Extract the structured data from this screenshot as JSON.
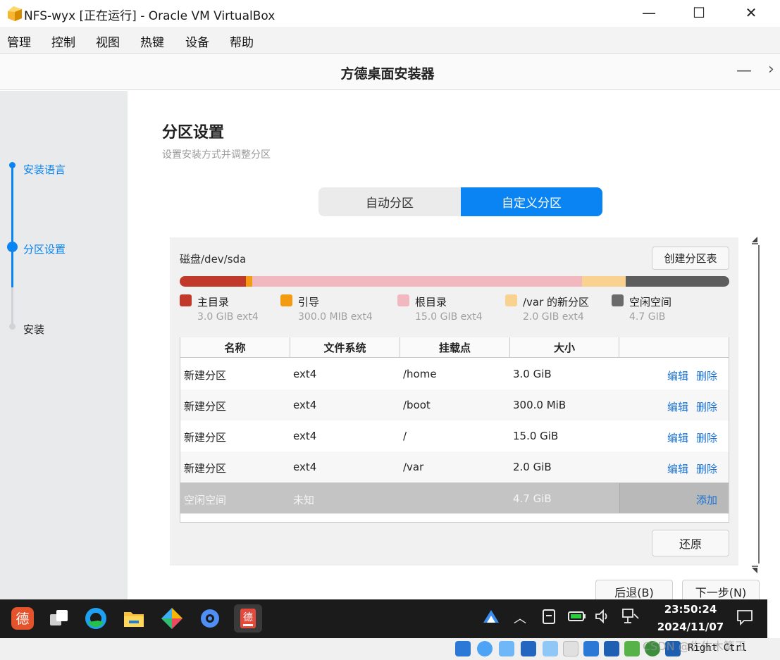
{
  "window": {
    "title": "NFS-wyx [正在运行] - Oracle VM VirtualBox",
    "minimize": "—",
    "maximize": "☐",
    "close": "✕",
    "icon": "virtualbox-icon"
  },
  "menu": [
    "管理",
    "控制",
    "视图",
    "热键",
    "设备",
    "帮助"
  ],
  "installer": {
    "title": "方德桌面安装器",
    "minimize": "—",
    "next_arrow": "›"
  },
  "steps": [
    {
      "label": "安装语言",
      "state": "done"
    },
    {
      "label": "分区设置",
      "state": "current"
    },
    {
      "label": "安装",
      "state": "pending"
    }
  ],
  "page": {
    "title": "分区设置",
    "subtitle": "设置安装方式并调整分区"
  },
  "tabs": {
    "auto": "自动分区",
    "custom": "自定义分区",
    "active": "custom"
  },
  "disk": {
    "label": "磁盘/dev/sda",
    "create_table_button": "创建分区表",
    "usage_segments": [
      {
        "name": "主目录",
        "gib": 3.0,
        "color": "#c0392b"
      },
      {
        "name": "引导",
        "gib": 0.293,
        "color": "#f39c12"
      },
      {
        "name": "根目录",
        "gib": 15.0,
        "color": "#f2b8c0"
      },
      {
        "name": "/var 的新分区",
        "gib": 2.0,
        "color": "#f8d28e"
      },
      {
        "name": "空闲空间",
        "gib": 4.7,
        "color": "#5d5d5d"
      }
    ]
  },
  "legend": [
    {
      "name": "主目录",
      "size": "3.0 GIB  ext4",
      "color": "#c0392b"
    },
    {
      "name": "引导",
      "size": "300.0 MIB  ext4",
      "color": "#f39c12"
    },
    {
      "name": "根目录",
      "size": "15.0 GIB  ext4",
      "color": "#f2b8c0"
    },
    {
      "name": "/var 的新分区",
      "size": "2.0 GIB  ext4",
      "color": "#f8d28e"
    },
    {
      "name": "空闲空间",
      "size": "4.7 GIB",
      "color": "#6b6b6b"
    }
  ],
  "table": {
    "headers": [
      "名称",
      "文件系统",
      "挂载点",
      "大小",
      ""
    ],
    "rows": [
      {
        "name": "新建分区",
        "fs": "ext4",
        "mount": "/home",
        "size": "3.0 GiB",
        "edit": "编辑",
        "delete": "删除"
      },
      {
        "name": "新建分区",
        "fs": "ext4",
        "mount": "/boot",
        "size": "300.0 MiB",
        "edit": "编辑",
        "delete": "删除"
      },
      {
        "name": "新建分区",
        "fs": "ext4",
        "mount": "/",
        "size": "15.0 GiB",
        "edit": "编辑",
        "delete": "删除"
      },
      {
        "name": "新建分区",
        "fs": "ext4",
        "mount": "/var",
        "size": "2.0 GiB",
        "edit": "编辑",
        "delete": "删除"
      }
    ],
    "free_row": {
      "name": "空闲空间",
      "fs": "未知",
      "mount": "",
      "size": "4.7 GiB",
      "add": "添加"
    }
  },
  "restore_button": "还原",
  "nav": {
    "back": "后退(B)",
    "next": "下一步(N)"
  },
  "taskbar": {
    "apps": [
      "deepin-logo-icon",
      "multitask-view-icon",
      "browser-icon",
      "file-manager-icon",
      "app-store-icon",
      "settings-gear-icon",
      "installer-icon"
    ],
    "time": "23:50:24",
    "date": "2024/11/07"
  },
  "statusbar": {
    "host_key": "Right Ctrl",
    "watermark": "CSDN @佐佐木篝王"
  },
  "colors": {
    "accent": "#0a84f2",
    "link": "#1a73d8",
    "sidebar_bg": "#e9eaeb"
  }
}
